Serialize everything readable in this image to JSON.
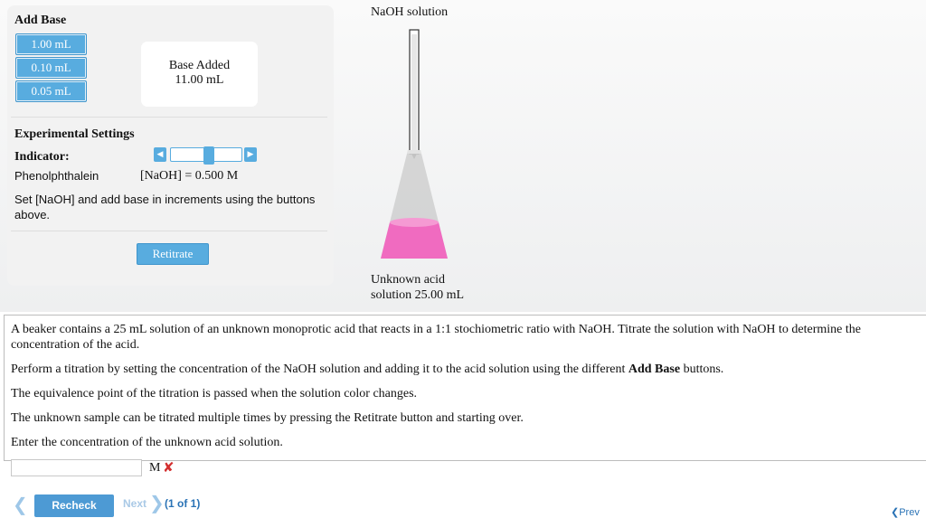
{
  "panel": {
    "title": "Add Base",
    "buttons": [
      "1.00 mL",
      "0.10 mL",
      "0.05 mL"
    ],
    "base_added_label": "Base Added",
    "base_added_value": "11.00 mL",
    "settings_title": "Experimental Settings",
    "indicator_label": "Indicator:",
    "indicator_value": "Phenolphthalein",
    "naoh_concentration": "[NaOH] = 0.500 M",
    "instructions": "Set [NaOH] and add base in increments using the buttons above.",
    "retitrate_label": "Retitrate"
  },
  "apparatus": {
    "naoh_label": "NaOH solution",
    "acid_label_line1": "Unknown acid",
    "acid_label_line2": "solution 25.00 mL",
    "solution_color": "#f06bc0"
  },
  "problem": {
    "p1": "A beaker contains a 25 mL solution of an unknown monoprotic acid that reacts in a 1:1 stochiometric ratio with NaOH. Titrate the solution with NaOH to determine the concentration of the acid.",
    "p2_pre": "Perform a titration by setting the concentration of the NaOH solution and adding it to the acid solution using the different ",
    "p2_bold": "Add Base",
    "p2_post": " buttons.",
    "p3": "The equivalence point of the titration is passed when the solution color changes.",
    "p4": "The unknown sample can be titrated multiple times by pressing the Retitrate button and starting over.",
    "p5": "Enter the concentration of the unknown acid solution."
  },
  "answer": {
    "value": "",
    "unit": "M",
    "status_icon": "x-icon"
  },
  "footer": {
    "recheck_label": "Recheck",
    "next_label": "Next",
    "pager": "(1 of 1)",
    "prev_label": "Prev"
  },
  "colors": {
    "button_blue": "#58acdf",
    "link_blue": "#2a73b6",
    "error_red": "#d32f2f"
  }
}
